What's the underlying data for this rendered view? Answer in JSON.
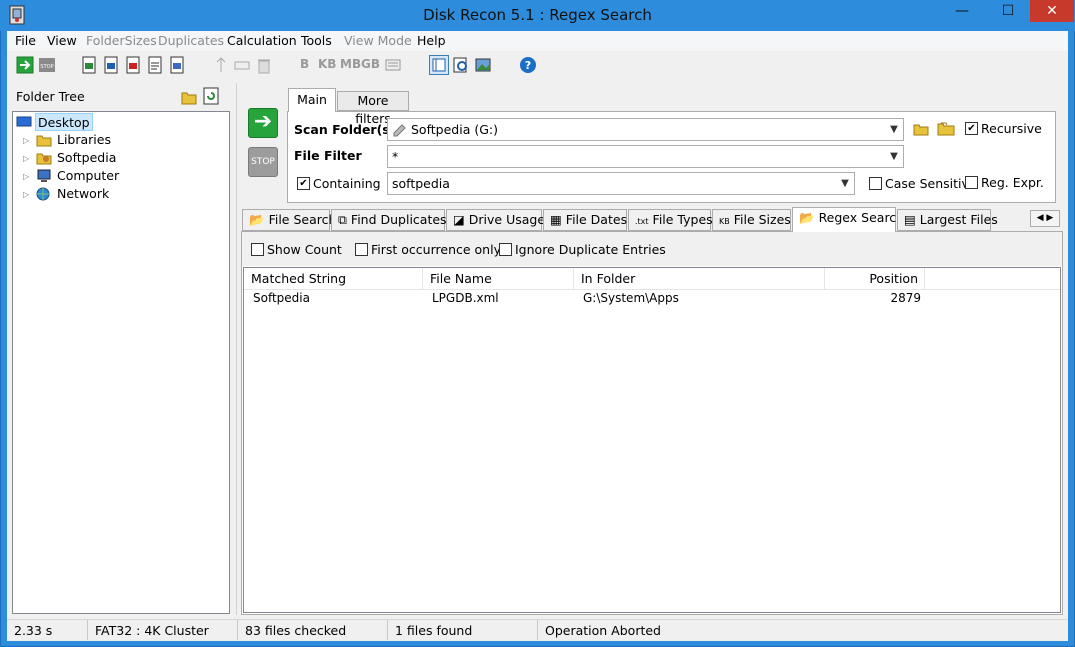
{
  "window": {
    "title": "Disk Recon 5.1 : Regex Search",
    "minimize": "—",
    "maximize": "☐",
    "close": "✕"
  },
  "menu": [
    {
      "label": "File",
      "enabled": true
    },
    {
      "label": "View",
      "enabled": true
    },
    {
      "label": "FolderSizes",
      "enabled": false
    },
    {
      "label": "Duplicates",
      "enabled": false
    },
    {
      "label": "Calculation",
      "enabled": true
    },
    {
      "label": "Tools",
      "enabled": true
    },
    {
      "label": "View Mode",
      "enabled": false
    },
    {
      "label": "Help",
      "enabled": true
    }
  ],
  "toolbar": {
    "unit_b": "B",
    "unit_kb": "KB",
    "unit_mb": "MB",
    "unit_gb": "GB"
  },
  "folder_tree": {
    "label": "Folder Tree",
    "nodes": [
      "Desktop",
      "Libraries",
      "Softpedia",
      "Computer",
      "Network"
    ]
  },
  "actions": {
    "go": "➔",
    "stop": "STOP"
  },
  "top_tabs": {
    "main": "Main",
    "more": "More filters"
  },
  "main": {
    "scan_label": "Scan Folder(s)",
    "scan_value": "Softpedia (G:)",
    "recursive_label": "Recursive",
    "filter_label": "File Filter",
    "filter_value": "*",
    "containing_label": "Containing",
    "containing_value": "softpedia",
    "case_label": "Case Sensitive",
    "regex_label": "Reg. Expr."
  },
  "tabs": [
    "File Search",
    "Find Duplicates",
    "Drive Usage",
    "File Dates",
    "File Types",
    "File Sizes",
    "Regex Search",
    "Largest Files"
  ],
  "options": {
    "show_count": "Show Count",
    "first_only": "First occurrence only",
    "ignore_dup": "Ignore Duplicate Entries"
  },
  "table": {
    "headers": [
      "Matched String",
      "File Name",
      "In Folder",
      "Position"
    ],
    "rows": [
      [
        "Softpedia",
        "LPGDB.xml",
        "G:\\System\\Apps",
        "2879"
      ]
    ]
  },
  "status": [
    "2.33 s",
    "FAT32 : 4K Cluster",
    "83 files checked",
    "1 files found",
    "Operation Aborted"
  ],
  "colors": {
    "titlebar": "#2d8ddc",
    "go": "#27a33c",
    "close": "#c7392b"
  }
}
